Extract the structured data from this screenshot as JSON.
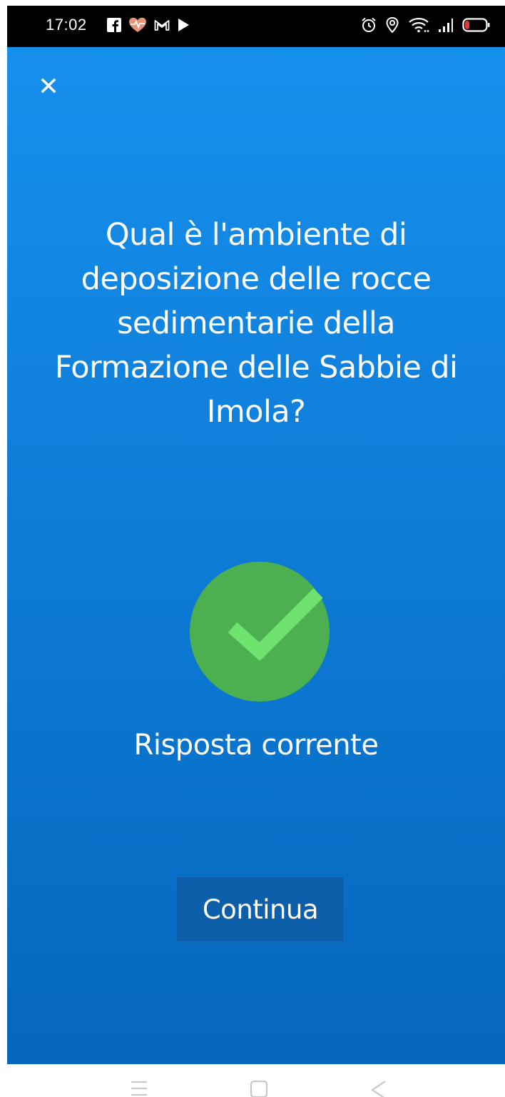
{
  "status_bar": {
    "time": "17:02",
    "left_icons": [
      "facebook-icon",
      "health-heart-icon",
      "gmail-icon",
      "play-icon"
    ],
    "right_icons": [
      "alarm-icon",
      "location-icon",
      "wifi-icon",
      "signal-icon",
      "battery-icon"
    ]
  },
  "quiz": {
    "question": "Qual è l'ambiente di deposizione delle rocce sedimentarie della Formazione delle Sabbie di Imola?",
    "question_lines": [
      "Qual è l'ambiente di",
      "deposizione delle rocce",
      "sedimentarie della",
      "Formazione delle Sabbie di",
      "Imola?"
    ],
    "result_label": "Risposta corrente",
    "continue_label": "Continua"
  },
  "colors": {
    "background_top": "#1690ed",
    "background_bottom": "#0566bc",
    "success_green": "#4caf50",
    "check_mark": "#6ee36e",
    "button_bg": "#0c5fa8"
  },
  "nav_bar": {
    "icons": [
      "menu-icon",
      "home-square-icon",
      "back-triangle-icon"
    ]
  }
}
